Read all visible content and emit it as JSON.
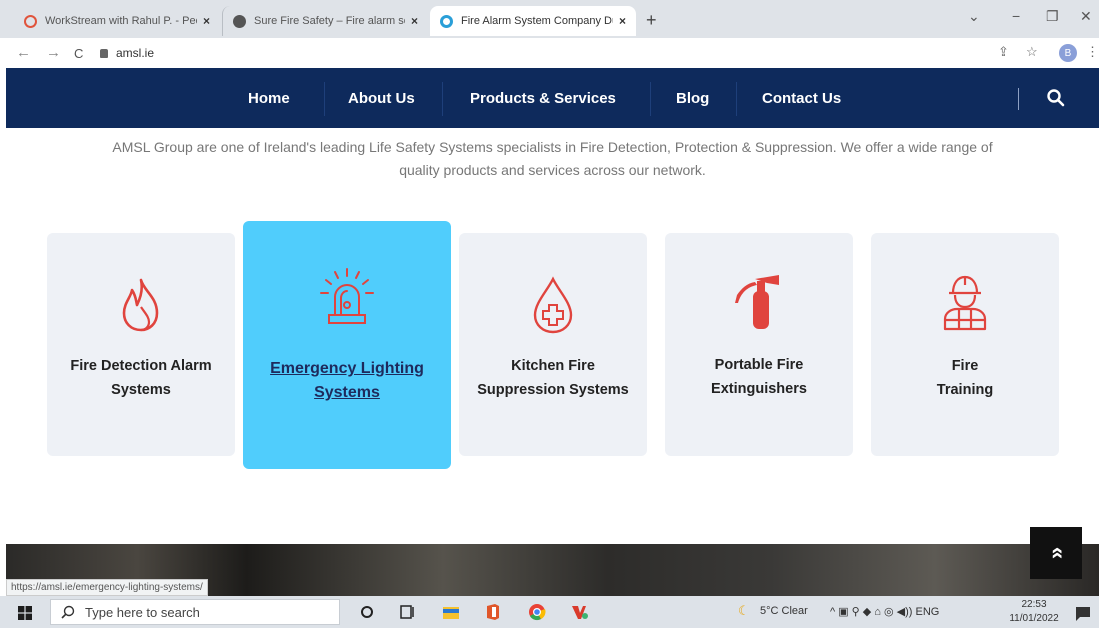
{
  "browser": {
    "tabs": [
      {
        "title": "WorkStream with Rahul P. - Peo",
        "close": "×",
        "icon_color": "#e0543c"
      },
      {
        "title": "Sure Fire Safety – Fire alarm serv",
        "close": "×",
        "icon_color": "#555555"
      },
      {
        "title": "Fire Alarm System Company Dub",
        "close": "×",
        "icon_color": "#2a9fd8"
      }
    ],
    "new_tab": "+",
    "url": "amsl.ie",
    "profile_initial": "B",
    "window_controls": {
      "min": "−",
      "restore": "❐",
      "close": "✕",
      "down": "⌄"
    },
    "nav": {
      "back": "←",
      "forward": "→",
      "reload": "C"
    },
    "toolbar": {
      "share": "⇪",
      "star": "☆",
      "menu": "⋮"
    }
  },
  "site_nav": {
    "links": [
      "Home",
      "About Us",
      "Products & Services",
      "Blog",
      "Contact Us"
    ],
    "search_icon": "search-icon",
    "bg_color": "#0e2a5c"
  },
  "intro": {
    "line1": "AMSL Group are one of Ireland's leading Life Safety Systems specialists in Fire Detection, Protection & Suppression. We offer a wide range of",
    "line2": "quality products and services across our network."
  },
  "services": [
    {
      "line1": "Fire Detection Alarm",
      "line2": "Systems",
      "icon": "flame-icon"
    },
    {
      "line1": "Emergency Lighting",
      "line2": "Systems",
      "icon": "siren-icon",
      "highlighted": true
    },
    {
      "line1": "Kitchen Fire",
      "line2": "Suppression Systems",
      "icon": "drop-cross-icon"
    },
    {
      "line1": "Portable Fire",
      "line2": "Extinguishers",
      "icon": "extinguisher-icon"
    },
    {
      "line1": "Fire",
      "line2": "Training",
      "icon": "firefighter-icon"
    }
  ],
  "colors": {
    "accent_red": "#e0443e",
    "highlight": "#50cdfc",
    "card_bg": "#eef1f6"
  },
  "status_url": "https://amsl.ie/emergency-lighting-systems/",
  "scroll_top": "»",
  "taskbar": {
    "search_placeholder": "Type here to search",
    "weather": "5°C  Clear",
    "tray": "^  ▣  ⚲  ◆  ⌂  ◎  ◀))  ENG",
    "time": "22:53",
    "date": "11/01/2022"
  }
}
